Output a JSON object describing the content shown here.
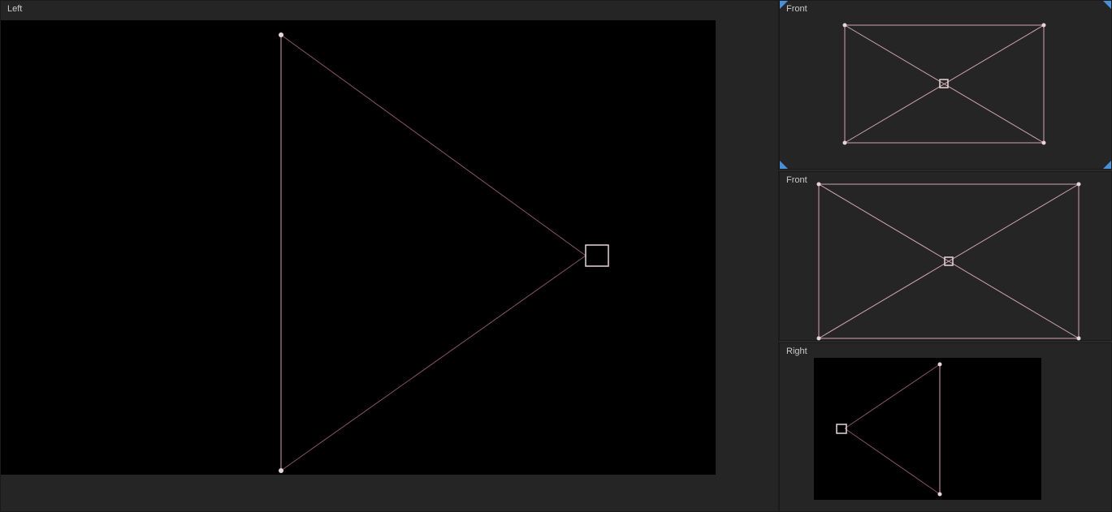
{
  "panels": {
    "left": {
      "label": "Left"
    },
    "front1": {
      "label": "Front"
    },
    "front2": {
      "label": "Front"
    },
    "right": {
      "label": "Right"
    }
  },
  "colors": {
    "wireframe": "#d4a5b0",
    "wireframeDim": "#8a5565",
    "vertex": "#e8d5da",
    "marker": "#4a90d9",
    "background": "#252525",
    "viewport": "#000000"
  }
}
